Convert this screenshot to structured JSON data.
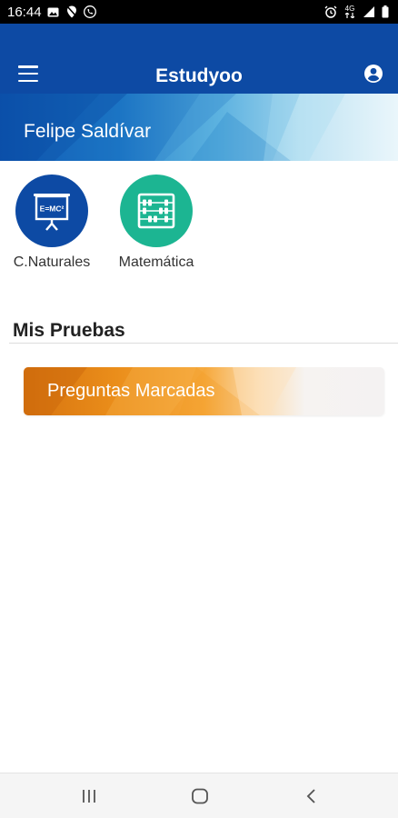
{
  "status_bar": {
    "time": "16:44",
    "left_icons": [
      "gallery-icon",
      "location-off-icon",
      "phone-icon"
    ],
    "right_icons": [
      "alarm-icon",
      "data-icon",
      "signal-icon",
      "battery-icon"
    ],
    "network_label": "4G"
  },
  "app_bar": {
    "title": "Estudyoo",
    "menu_icon": "hamburger-menu-icon",
    "account_icon": "account-circle-icon",
    "color": "#0d4aa4"
  },
  "profile": {
    "name": "Felipe Saldívar"
  },
  "subjects": [
    {
      "label": "C.Naturales",
      "icon": "whiteboard-formula-icon",
      "board_text": "E=MC²",
      "color": "#0d4aa4"
    },
    {
      "label": "Matemática",
      "icon": "abacus-icon",
      "color": "#1cb592"
    }
  ],
  "tests_section": {
    "title": "Mis Pruebas",
    "cards": [
      {
        "label": "Preguntas Marcadas",
        "accent": "#e8851a"
      }
    ]
  },
  "nav_bar": {
    "buttons": [
      "recent-apps-icon",
      "home-icon",
      "back-icon"
    ]
  }
}
